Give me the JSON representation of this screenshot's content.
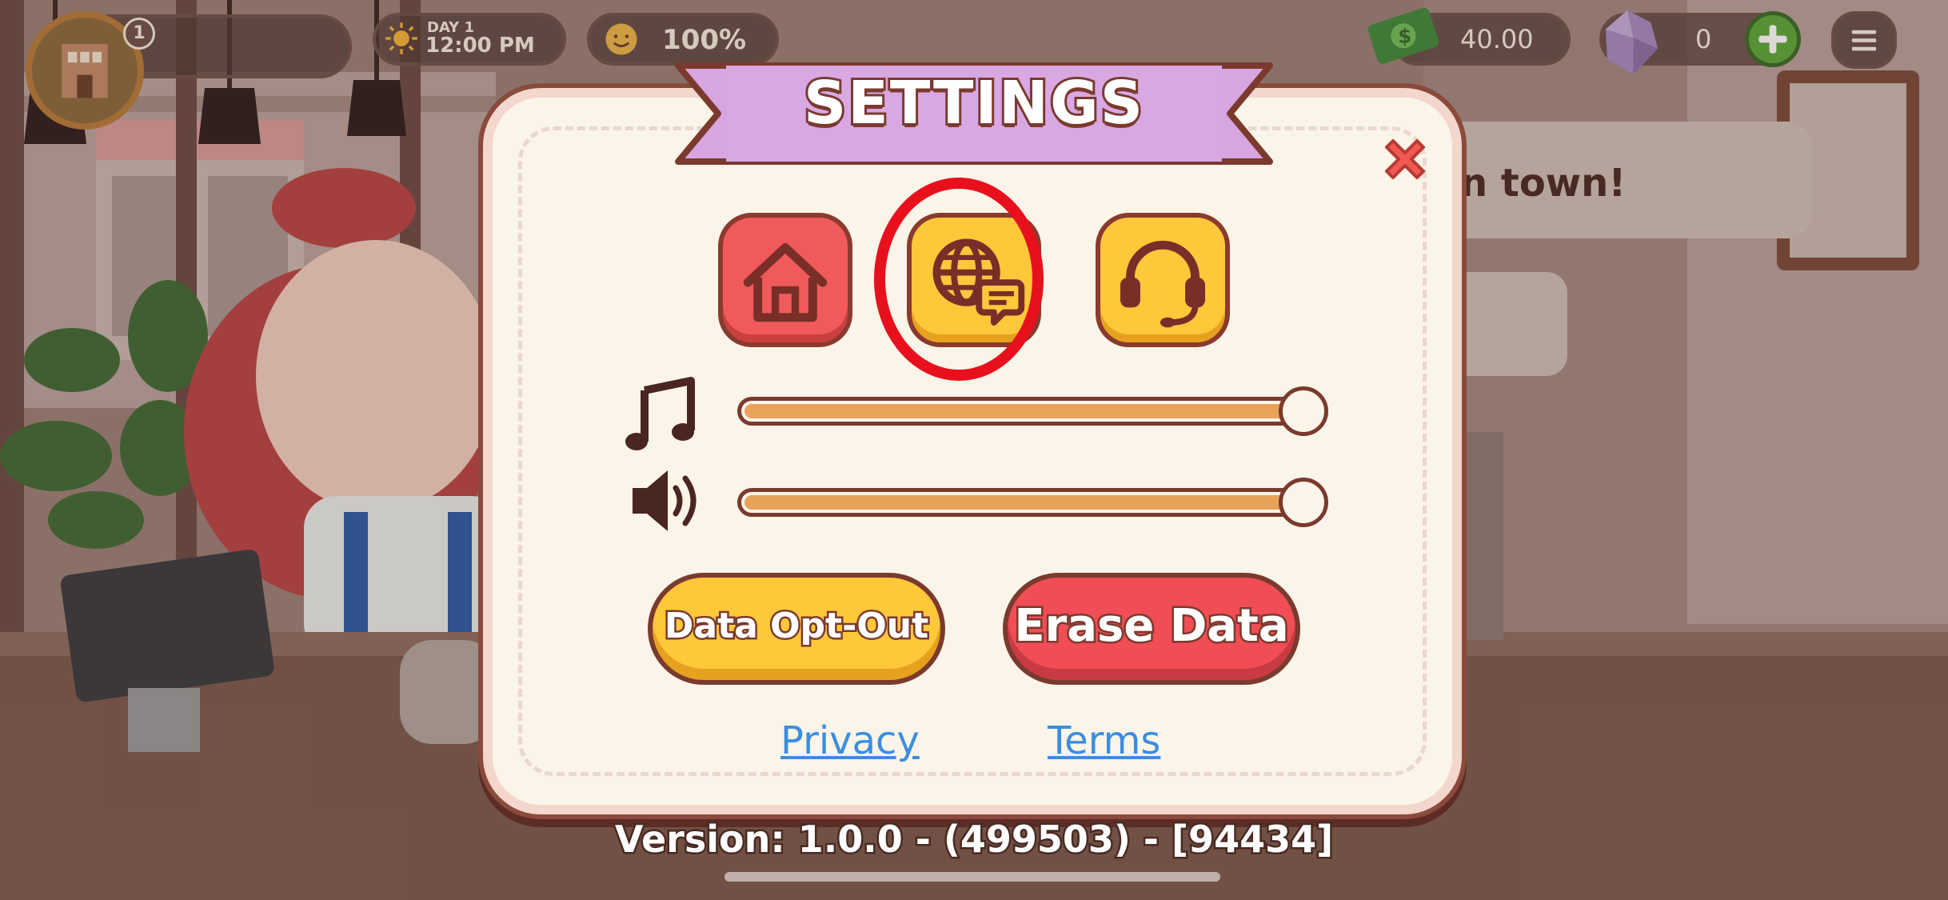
{
  "hud": {
    "level_badge": "1",
    "day_label": "DAY 1",
    "time": "12:00 PM",
    "happiness": "100%",
    "cash": "40.00",
    "gems": "0"
  },
  "scene": {
    "bubble_text": "n town!"
  },
  "settings": {
    "title": "SETTINGS",
    "tabs": [
      {
        "icon": "house-icon",
        "color": "#f15a5a"
      },
      {
        "icon": "language-globe-icon",
        "color": "#ffc73a",
        "highlighted": true
      },
      {
        "icon": "headset-icon",
        "color": "#ffc73a"
      }
    ],
    "music_level_percent": 100,
    "sound_level_percent": 100,
    "data_optout_label": "Data Opt-Out",
    "erase_data_label": "Erase Data",
    "privacy_link": "Privacy",
    "terms_link": "Terms",
    "version": "Version: 1.0.0 - (499503) - [94434]",
    "highlight_color": "#e8101c"
  }
}
